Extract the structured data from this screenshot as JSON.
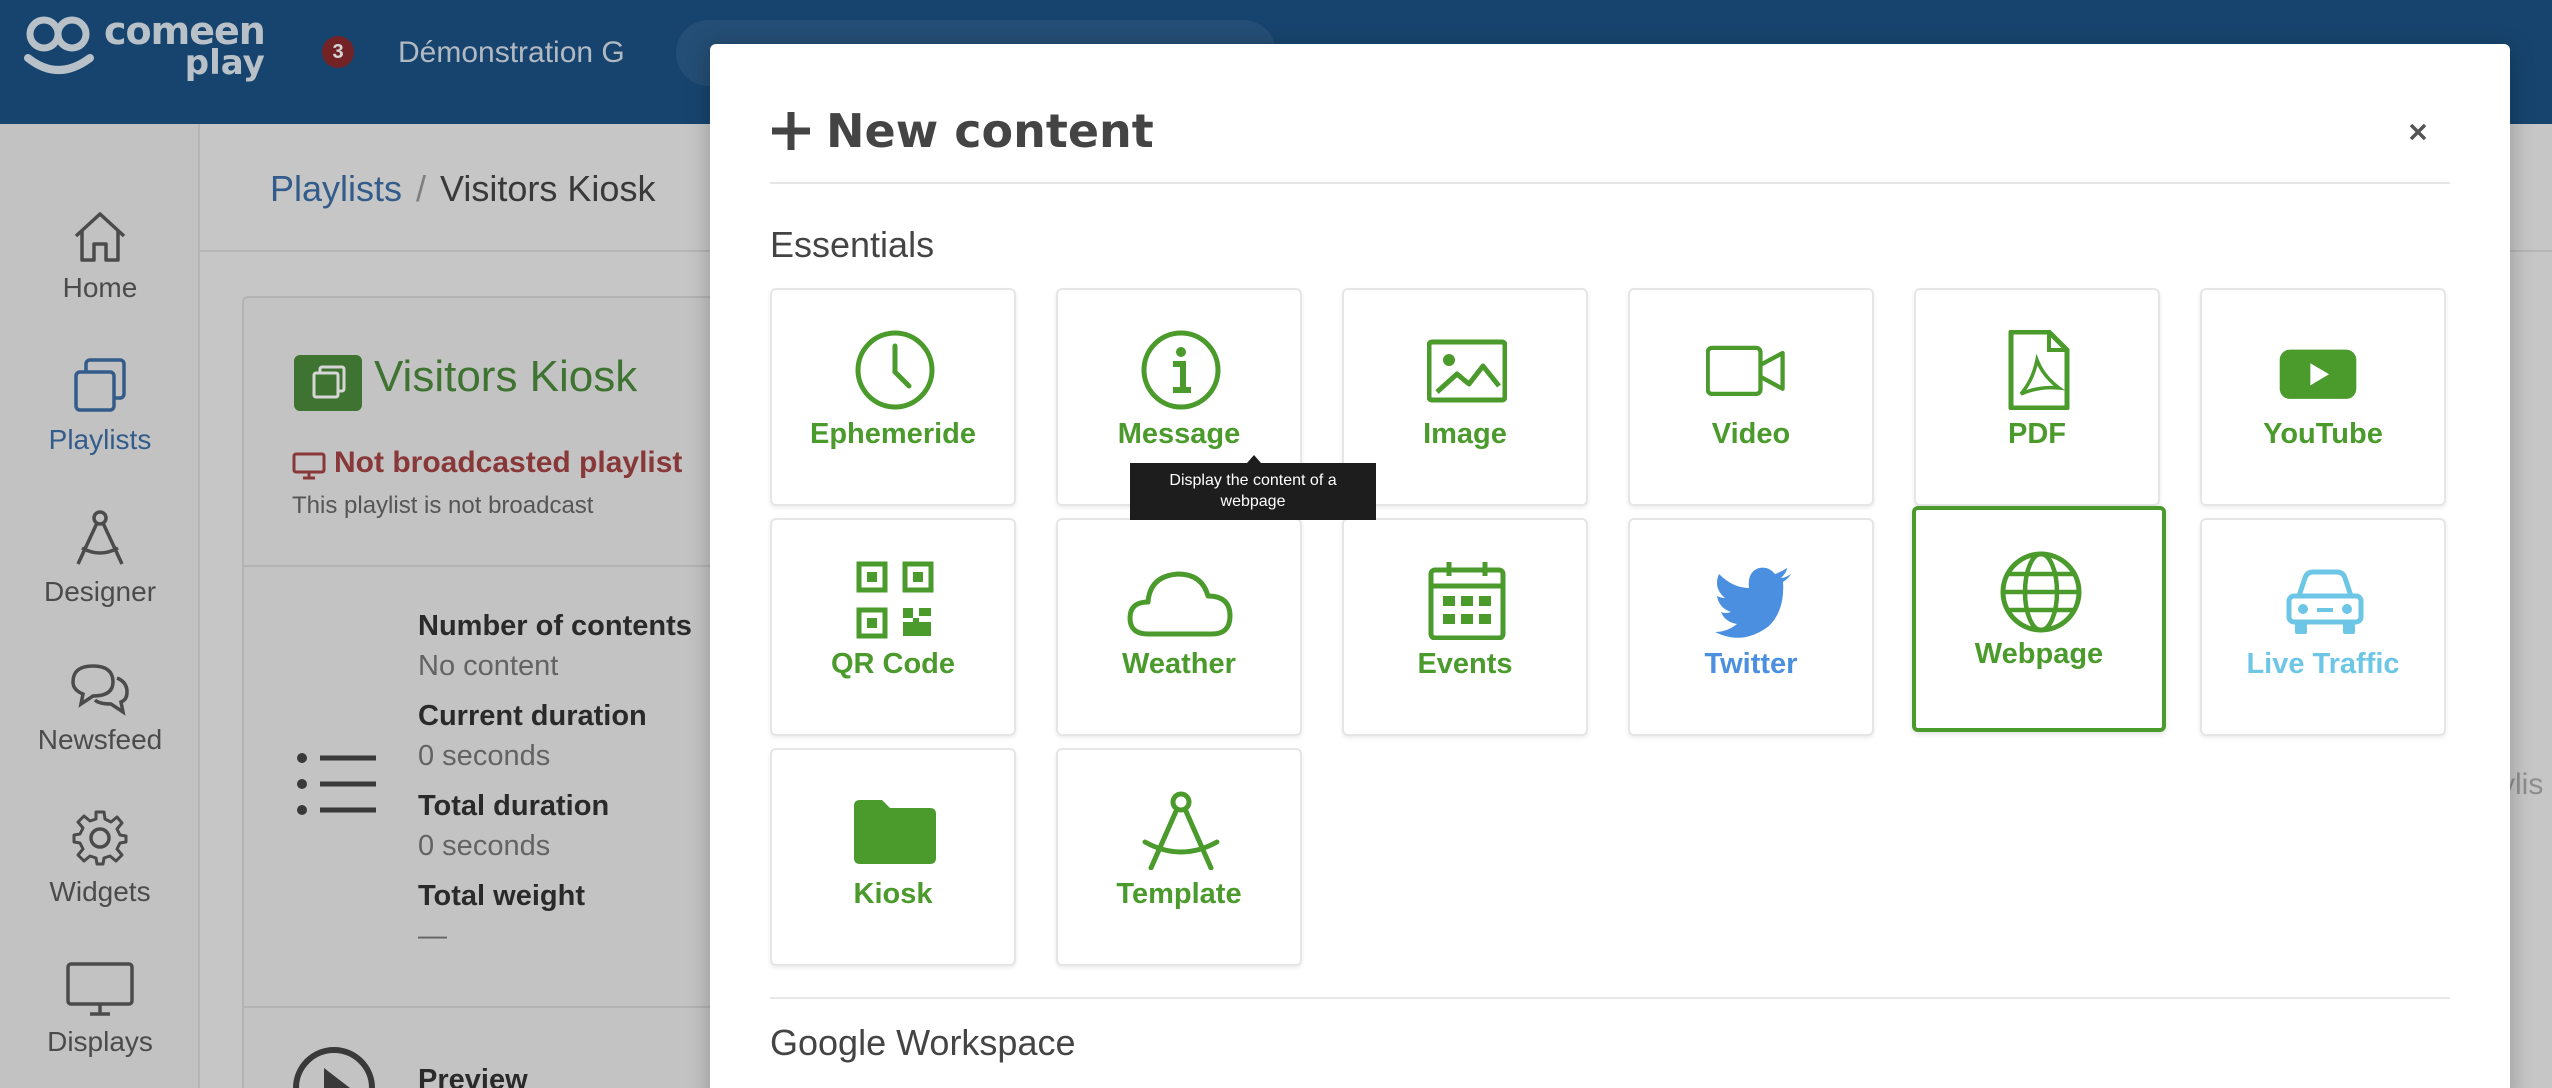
{
  "topbar": {
    "logo_line1": "comeen",
    "logo_line2": "play",
    "notification_count": "3",
    "organization": "Démonstration G"
  },
  "sidebar": {
    "items": [
      {
        "label": "Home",
        "icon": "home-icon"
      },
      {
        "label": "Playlists",
        "icon": "playlists-icon",
        "active": true
      },
      {
        "label": "Designer",
        "icon": "compass-icon"
      },
      {
        "label": "Newsfeed",
        "icon": "chat-icon"
      },
      {
        "label": "Widgets",
        "icon": "gear-icon"
      },
      {
        "label": "Displays",
        "icon": "monitor-icon"
      }
    ]
  },
  "breadcrumb": {
    "parent": "Playlists",
    "separator": "/",
    "current": "Visitors Kiosk"
  },
  "playlist": {
    "title": "Visitors Kiosk",
    "status": "Not broadcasted playlist",
    "status_desc": "This playlist is not broadcast",
    "stats": [
      {
        "label": "Number of contents",
        "value": "No content"
      },
      {
        "label": "Current duration",
        "value": "0 seconds"
      },
      {
        "label": "Total duration",
        "value": "0 seconds"
      },
      {
        "label": "Total weight",
        "value": "—"
      }
    ],
    "preview_label": "Preview",
    "right_fragment": "ylis"
  },
  "modal": {
    "title": "New content",
    "sections": [
      {
        "title": "Essentials",
        "items": [
          {
            "label": "Ephemeride",
            "icon": "clock-icon"
          },
          {
            "label": "Message",
            "icon": "info-icon"
          },
          {
            "label": "Image",
            "icon": "image-icon"
          },
          {
            "label": "Video",
            "icon": "video-camera-icon"
          },
          {
            "label": "PDF",
            "icon": "pdf-file-icon"
          },
          {
            "label": "YouTube",
            "icon": "youtube-icon"
          },
          {
            "label": "QR Code",
            "icon": "qr-code-icon"
          },
          {
            "label": "Weather",
            "icon": "cloud-icon"
          },
          {
            "label": "Events",
            "icon": "calendar-icon"
          },
          {
            "label": "Twitter",
            "icon": "twitter-bird-icon"
          },
          {
            "label": "Webpage",
            "icon": "globe-icon",
            "selected": true
          },
          {
            "label": "Live Traffic",
            "icon": "car-icon"
          },
          {
            "label": "Kiosk",
            "icon": "folder-icon"
          },
          {
            "label": "Template",
            "icon": "compass-icon"
          }
        ]
      },
      {
        "title": "Google Workspace",
        "items": []
      }
    ],
    "tooltip": {
      "line1": "Display the content of a",
      "line2": "webpage"
    }
  },
  "colors": {
    "topbar": "#1c5284",
    "accent_green": "#4a9a2c",
    "twitter_blue": "#4a8fe0",
    "traffic_cyan": "#6dc6e6",
    "alert_red": "#a34343",
    "playlist_green": "#4c8a3c",
    "link_blue": "#3d6ea5"
  }
}
